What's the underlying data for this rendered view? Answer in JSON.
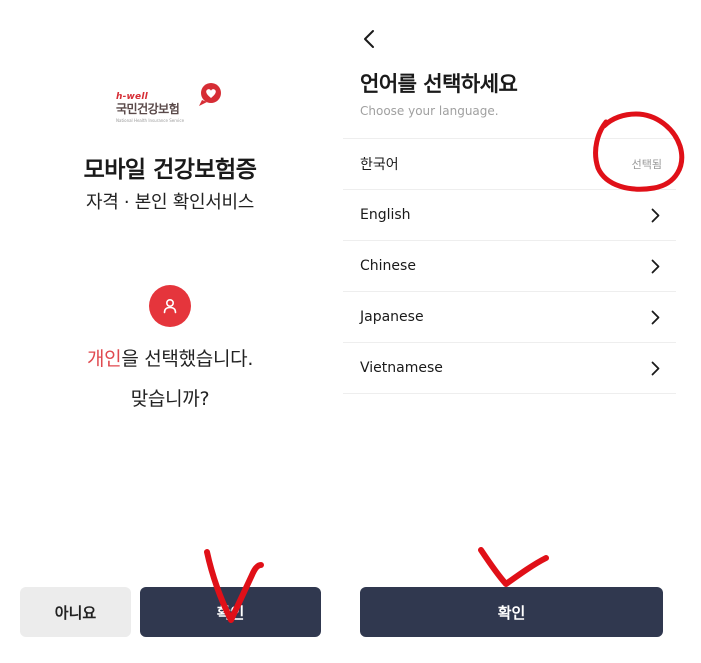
{
  "left_screen": {
    "logo": {
      "brand": "h-well",
      "name": "국민건강보험",
      "sub": "National Health Insurance Service"
    },
    "title": "모바일 건강보험증",
    "subtitle": "자격 · 본인 확인서비스",
    "question": {
      "highlight": "개인",
      "rest": "을 선택했습니다.",
      "line2": "맞습니까?"
    },
    "buttons": {
      "no_label": "아니요",
      "ok_label": "확인"
    }
  },
  "right_screen": {
    "title": "언어를 선택하세요",
    "subtitle": "Choose your language.",
    "languages": [
      {
        "label": "한국어",
        "status": "선택됨"
      },
      {
        "label": "English"
      },
      {
        "label": "Chinese"
      },
      {
        "label": "Japanese"
      },
      {
        "label": "Vietnamese"
      }
    ],
    "ok_label": "확인"
  },
  "colors": {
    "accent_red": "#e5353c",
    "button_navy": "#30384f",
    "button_gray": "#ececec",
    "annotation_red": "#e01018"
  },
  "icons": [
    "heart-logo-icon",
    "person-icon",
    "back-arrow-icon",
    "chevron-right-icon"
  ]
}
